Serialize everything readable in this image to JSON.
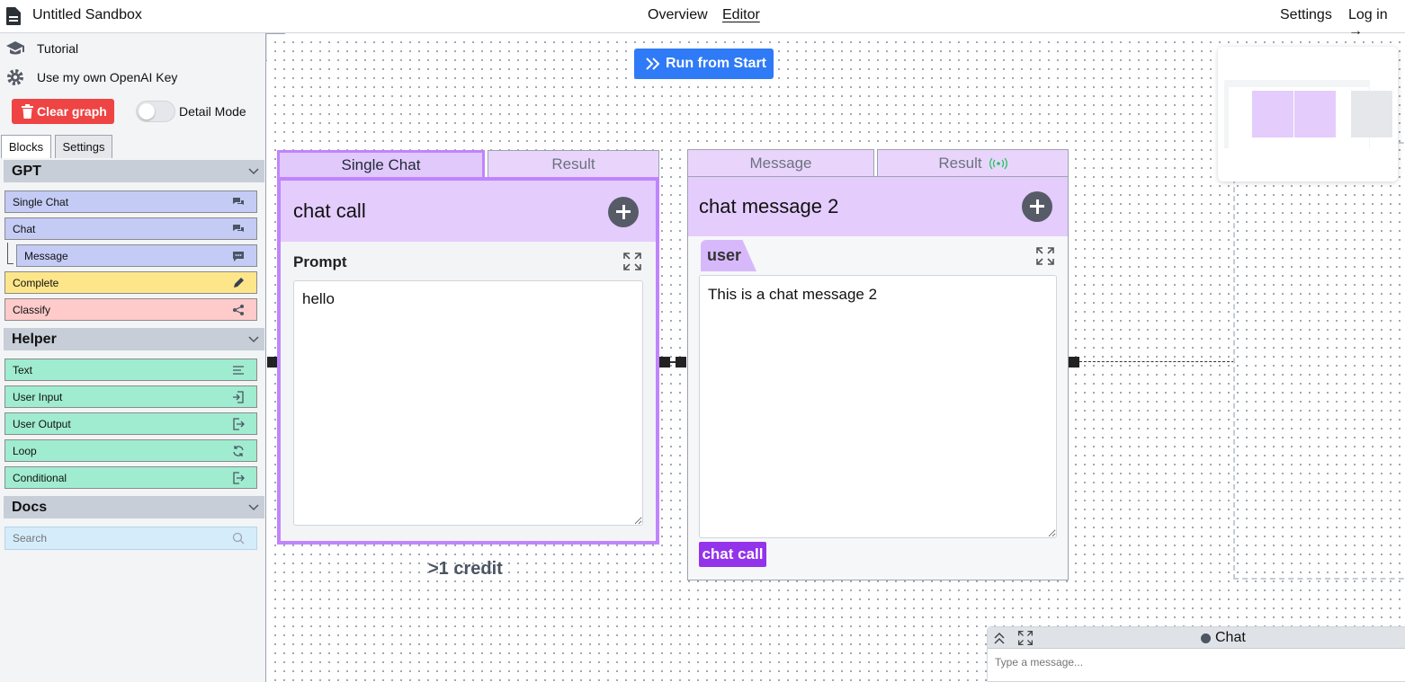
{
  "header": {
    "title": "Untitled Sandbox",
    "nav": [
      "Overview",
      "Editor"
    ],
    "settings": "Settings",
    "login": "Log in →"
  },
  "sidebar": {
    "tutorial": "Tutorial",
    "own_key": "Use my own OpenAI Key",
    "clear_graph": "Clear graph",
    "detail_mode": "Detail Mode",
    "tabs": [
      "Blocks",
      "Settings"
    ],
    "sections": {
      "gpt": "GPT",
      "helper": "Helper",
      "docs": "Docs"
    },
    "gpt_blocks": [
      "Single Chat",
      "Chat",
      "Message",
      "Complete",
      "Classify"
    ],
    "helper_blocks": [
      "Text",
      "User Input",
      "User Output",
      "Loop",
      "Conditional"
    ],
    "search_placeholder": "Search"
  },
  "canvas": {
    "run_button": "Run from Start",
    "node1": {
      "tabs": [
        "Single Chat",
        "Result"
      ],
      "title": "chat call",
      "field_label": "Prompt",
      "prompt": "hello",
      "credit": ">1 credit"
    },
    "node2": {
      "tabs": [
        "Message",
        "Result"
      ],
      "title": "chat message 2",
      "role": "user",
      "message": "This is a chat message 2",
      "tag": "chat call"
    }
  },
  "chat": {
    "label": "Chat",
    "placeholder": "Type a message..."
  }
}
